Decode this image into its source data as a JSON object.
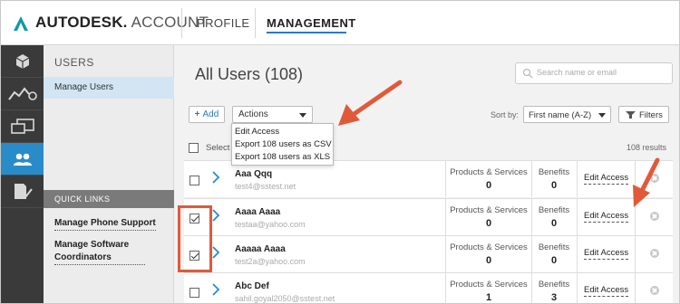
{
  "header": {
    "brand_bold": "AUTODESK.",
    "brand_light": "ACCOUNT",
    "nav": {
      "profile": "PROFILE",
      "management": "MANAGEMENT"
    }
  },
  "rail": {
    "icons": [
      "cube-icon",
      "analytics-icon",
      "devices-icon",
      "users-icon",
      "document-check-icon"
    ],
    "active_index": 3
  },
  "sidebar": {
    "title": "USERS",
    "active_item": "Manage Users",
    "quick_links_heading": "QUICK LINKS",
    "quick_links": [
      "Manage Phone Support",
      "Manage Software Coordinators"
    ]
  },
  "main": {
    "title": "All Users (108)",
    "search_placeholder": "Search name or email",
    "add_label": "Add",
    "actions_label": "Actions",
    "actions_menu": [
      "Edit Access",
      "Export 108 users as CSV",
      "Export 108 users as XLS"
    ],
    "sort_by_label": "Sort by:",
    "sort_value": "First name (A-Z)",
    "filters_label": "Filters",
    "select_all_label": "Select",
    "results_count": "108 results"
  },
  "table": {
    "col_products": "Products & Services",
    "col_benefits": "Benefits",
    "edit_access_label": "Edit Access",
    "rows": [
      {
        "name": "Aaa Qqq",
        "email": "test4@sstest.net",
        "products": "0",
        "benefits": "0",
        "checked": false
      },
      {
        "name": "Aaaa Aaaa",
        "email": "testaa@yahoo.com",
        "products": "0",
        "benefits": "0",
        "checked": true
      },
      {
        "name": "Aaaaa Aaaa",
        "email": "test2a@yahoo.com",
        "products": "0",
        "benefits": "0",
        "checked": true
      },
      {
        "name": "Abc Def",
        "email": "sahil.goyal2050@sstest.net",
        "products": "1",
        "benefits": "3",
        "checked": false
      }
    ]
  },
  "colors": {
    "accent": "#2a7bbf",
    "rail_bg": "#3a3a3a",
    "rail_active": "#2a8bc9",
    "annotation": "#e05a3a"
  }
}
